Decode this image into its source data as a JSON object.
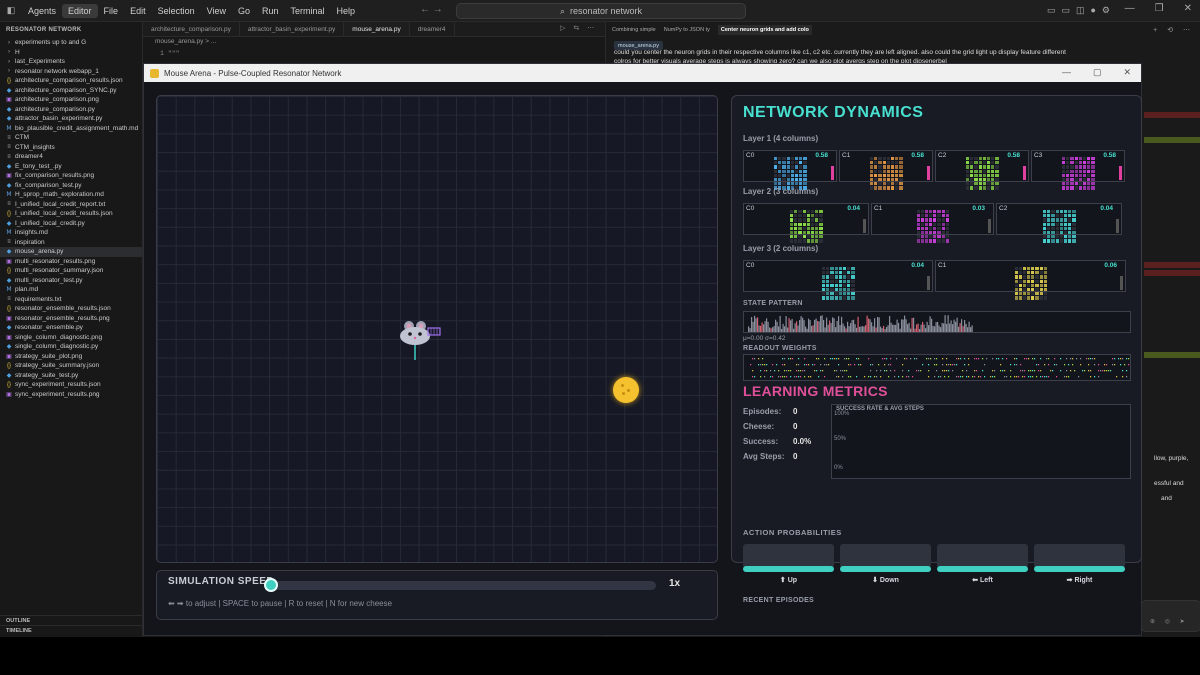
{
  "ide": {
    "menu": [
      "Agents",
      "Editor",
      "File",
      "Edit",
      "Selection",
      "View",
      "Go",
      "Run",
      "Terminal",
      "Help"
    ],
    "active_menu": "Editor",
    "search": "resonator network",
    "tabs": [
      {
        "label": "architecture_comparison.py",
        "active": false
      },
      {
        "label": "attractor_basin_experiment.py",
        "active": false
      },
      {
        "label": "mouse_arena.py",
        "active": true
      },
      {
        "label": "dreamer4",
        "active": false
      }
    ],
    "breadcrumb": "mouse_arena.py > ...",
    "code_line_num": "1",
    "code_line_text": "\"\"\""
  },
  "sidebar": {
    "title": "RESONATOR NETWORK",
    "outline": "OUTLINE",
    "timeline": "TIMELINE",
    "files": [
      {
        "label": "experiments up to and G",
        "icon": "folder"
      },
      {
        "label": "H",
        "icon": "folder"
      },
      {
        "label": "last_Experiments",
        "icon": "folder"
      },
      {
        "label": "resonator network webapp_1",
        "icon": "folder"
      },
      {
        "label": "architecture_comparison_results.json",
        "icon": "json"
      },
      {
        "label": "architecture_comparison_SYNC.py",
        "icon": "py"
      },
      {
        "label": "architecture_comparison.png",
        "icon": "img"
      },
      {
        "label": "architecture_comparison.py",
        "icon": "py"
      },
      {
        "label": "attractor_basin_experiment.py",
        "icon": "py"
      },
      {
        "label": "bio_plausible_credit_assignment_math.md",
        "icon": "md"
      },
      {
        "label": "CTM",
        "icon": "file"
      },
      {
        "label": "CTM_insights",
        "icon": "file"
      },
      {
        "label": "dreamer4",
        "icon": "file"
      },
      {
        "label": "E_tony_test_.py",
        "icon": "py"
      },
      {
        "label": "fix_comparison_results.png",
        "icon": "img"
      },
      {
        "label": "fix_comparison_test.py",
        "icon": "py"
      },
      {
        "label": "H_sprop_math_exploration.md",
        "icon": "md"
      },
      {
        "label": "I_unified_local_credit_report.txt",
        "icon": "txt"
      },
      {
        "label": "I_unified_local_credit_results.json",
        "icon": "json"
      },
      {
        "label": "I_unified_local_credit.py",
        "icon": "py"
      },
      {
        "label": "insights.md",
        "icon": "md"
      },
      {
        "label": "inspiration",
        "icon": "file"
      },
      {
        "label": "mouse_arena.py",
        "icon": "py",
        "selected": true
      },
      {
        "label": "multi_resonator_results.png",
        "icon": "img"
      },
      {
        "label": "multi_resonator_summary.json",
        "icon": "json"
      },
      {
        "label": "multi_resonator_test.py",
        "icon": "py"
      },
      {
        "label": "plan.md",
        "icon": "md"
      },
      {
        "label": "requirements.txt",
        "icon": "txt"
      },
      {
        "label": "resonator_ensemble_results.json",
        "icon": "json"
      },
      {
        "label": "resonator_ensemble_results.png",
        "icon": "img"
      },
      {
        "label": "resonator_ensemble.py",
        "icon": "py"
      },
      {
        "label": "single_column_diagnostic.png",
        "icon": "img"
      },
      {
        "label": "single_column_diagnostic.py",
        "icon": "py"
      },
      {
        "label": "strategy_suite_plot.png",
        "icon": "img"
      },
      {
        "label": "strategy_suite_summary.json",
        "icon": "json"
      },
      {
        "label": "strategy_suite_test.py",
        "icon": "py"
      },
      {
        "label": "sync_experiment_results.json",
        "icon": "json"
      },
      {
        "label": "sync_experiment_results.png",
        "icon": "img"
      }
    ]
  },
  "chat": {
    "tabs": [
      {
        "label": "Combining simple",
        "active": false
      },
      {
        "label": "NumPy to JSON ty",
        "active": false
      },
      {
        "label": "Center neuron grids and add colo",
        "active": true
      }
    ],
    "file_chip": "mouse_arena.py",
    "message": "could you center the neuron grids in their respective columns like c1, c2 etc. currently they are left aligned. also could the grid light up display feature different colros for better visuals average steps is always showing zero? can we also plot avergs step on the plot dipsenerbel",
    "side_text_1": "llow, purple,",
    "side_text_2": "essful and",
    "side_text_3": "and"
  },
  "app": {
    "title": "Mouse Arena - Pulse-Coupled Resonator Network",
    "speed": {
      "label": "SIMULATION SPEED",
      "value_label": "1x",
      "value": 0.02,
      "help": "⬅ ➡ to adjust | SPACE to pause | R to reset | N for new cheese"
    },
    "dynamics": {
      "title": "NETWORK DYNAMICS",
      "layers": [
        {
          "label": "Layer 1 (4 columns)",
          "columns": [
            {
              "name": "C0",
              "value": "0.58",
              "color": "#4fb3f0"
            },
            {
              "name": "C1",
              "value": "0.58",
              "color": "#f0a04a"
            },
            {
              "name": "C2",
              "value": "0.58",
              "color": "#8fe04a"
            },
            {
              "name": "C3",
              "value": "0.58",
              "color": "#d040e0"
            }
          ]
        },
        {
          "label": "Layer 2 (3 columns)",
          "columns": [
            {
              "name": "C0",
              "value": "0.04",
              "color": "#8fe04a"
            },
            {
              "name": "C1",
              "value": "0.03",
              "color": "#d040e0"
            },
            {
              "name": "C2",
              "value": "0.04",
              "color": "#48d0d0"
            }
          ]
        },
        {
          "label": "Layer 3 (2 columns)",
          "columns": [
            {
              "name": "C0",
              "value": "0.04",
              "color": "#48d0d0"
            },
            {
              "name": "C1",
              "value": "0.06",
              "color": "#e0d050"
            }
          ]
        }
      ],
      "state_pattern_label": "STATE PATTERN",
      "state_stats": "μ=0.00 σ=0.42",
      "readout_label": "READOUT WEIGHTS"
    },
    "learning": {
      "title": "LEARNING METRICS",
      "metrics": [
        {
          "label": "Episodes:",
          "value": "0"
        },
        {
          "label": "Cheese:",
          "value": "0"
        },
        {
          "label": "Success:",
          "value": "0.0%"
        },
        {
          "label": "Avg Steps:",
          "value": "0"
        }
      ],
      "chart_title": "SUCCESS RATE & AVG STEPS",
      "ticks": [
        "100%",
        "50%",
        "0%"
      ]
    },
    "actions": {
      "title": "ACTION PROBABILITIES",
      "items": [
        {
          "label": "⬆ Up",
          "prob": 0.25
        },
        {
          "label": "⬇ Down",
          "prob": 0.25
        },
        {
          "label": "⬅ Left",
          "prob": 0.25
        },
        {
          "label": "➡ Right",
          "prob": 0.25
        }
      ]
    },
    "recent_label": "RECENT EPISODES"
  },
  "colors": {
    "accent": "#3fd0c2",
    "title_cyan": "#48e0d0",
    "title_pink": "#e0509a",
    "cheese": "#f5c12e"
  }
}
